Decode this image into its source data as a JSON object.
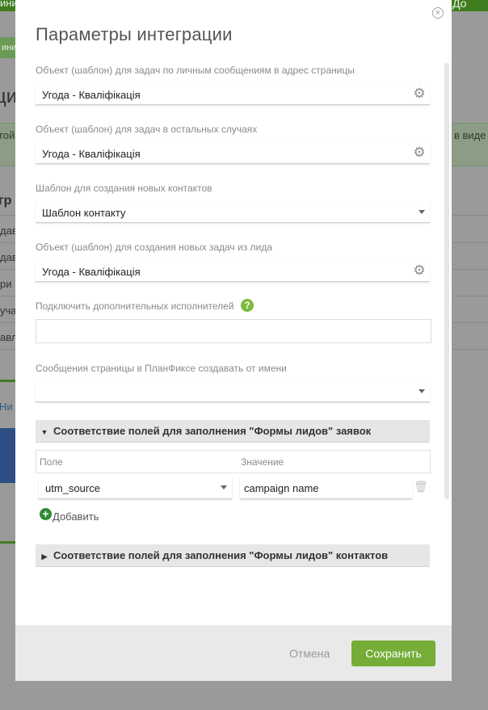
{
  "background": {
    "top_left": "ини",
    "top_right": "До",
    "left_tab": "ини",
    "heading": "ци",
    "band_left": "той",
    "band_right": "в виде",
    "column_head": "гр",
    "rows": [
      "дав",
      "дав",
      "ри",
      "уча",
      "авл"
    ],
    "link": "Ни"
  },
  "modal": {
    "title": "Параметры интеграции",
    "fields": {
      "personal_messages": {
        "label": "Объект (шаблон) для задач по личным сообщениям в адрес страницы",
        "value": "Угода - Кваліфікація"
      },
      "other_cases": {
        "label": "Объект (шаблон) для задач в остальных случаях",
        "value": "Угода - Кваліфікація"
      },
      "new_contacts": {
        "label": "Шаблон для создания новых контактов",
        "value": "Шаблон контакту"
      },
      "lead_tasks": {
        "label": "Объект (шаблон) для создания новых задач из лида",
        "value": "Угода - Кваліфікація"
      },
      "extra_executors": {
        "label": "Подключить дополнительных исполнителей",
        "value": "",
        "help": "?"
      },
      "sender": {
        "label": "Сообщения страницы в ПланФиксе создавать от имени",
        "value": ""
      }
    },
    "mapping_tasks": {
      "title": "Соответствие полей для заполнения \"Формы лидов\" заявок",
      "col_field": "Поле",
      "col_value": "Значение",
      "row_field": "utm_source",
      "row_value": "campaign name",
      "add_label": "Добавить"
    },
    "mapping_contacts": {
      "title": "Соответствие полей для заполнения \"Формы лидов\" контактов"
    },
    "icons": {
      "close": "×",
      "gear": "⚙",
      "trash": "🗑",
      "add": "+",
      "expanded": "▼",
      "collapsed": "▶"
    },
    "footer": {
      "cancel": "Отмена",
      "save": "Сохранить"
    }
  }
}
